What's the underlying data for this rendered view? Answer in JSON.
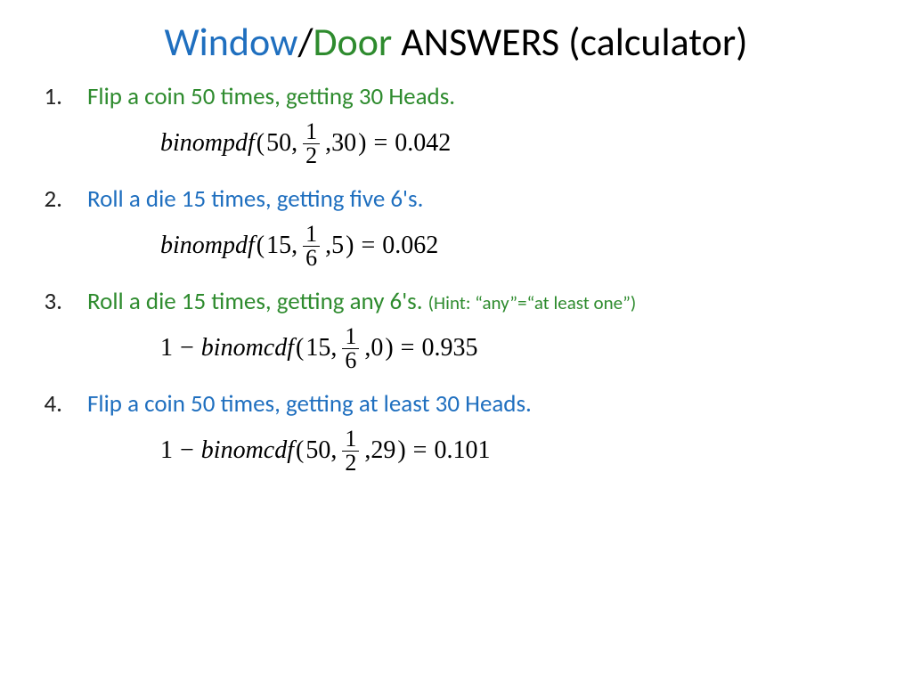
{
  "title": {
    "word1": "Window",
    "slash": "/",
    "word2": "Door",
    "rest": " ANSWERS (calculator)"
  },
  "items": [
    {
      "num": "1.",
      "color": "green",
      "text": "Flip a coin 50 times, getting 30 Heads.",
      "hint": "",
      "formula": {
        "prefix": "",
        "func": "binompdf",
        "n": "50",
        "p_num": "1",
        "p_den": "2",
        "k": "30",
        "result": "0.042"
      }
    },
    {
      "num": "2.",
      "color": "blue",
      "text": "Roll a die 15 times, getting five 6's.",
      "hint": "",
      "formula": {
        "prefix": "",
        "func": "binompdf",
        "n": "15",
        "p_num": "1",
        "p_den": "6",
        "k": "5",
        "result": "0.062"
      }
    },
    {
      "num": "3.",
      "color": "green",
      "text": "Roll a die 15 times, getting any 6's. ",
      "hint": "(Hint: “any”=“at least one”)",
      "formula": {
        "prefix": "1 − ",
        "func": "binomcdf",
        "n": "15",
        "p_num": "1",
        "p_den": "6",
        "k": "0",
        "result": "0.935"
      }
    },
    {
      "num": "4.",
      "color": "blue",
      "text": "Flip a coin 50 times, getting at least 30 Heads.",
      "hint": "",
      "formula": {
        "prefix": "1 − ",
        "func": "binomcdf",
        "n": "50",
        "p_num": "1",
        "p_den": "2",
        "k": "29",
        "result": "0.101"
      }
    }
  ]
}
